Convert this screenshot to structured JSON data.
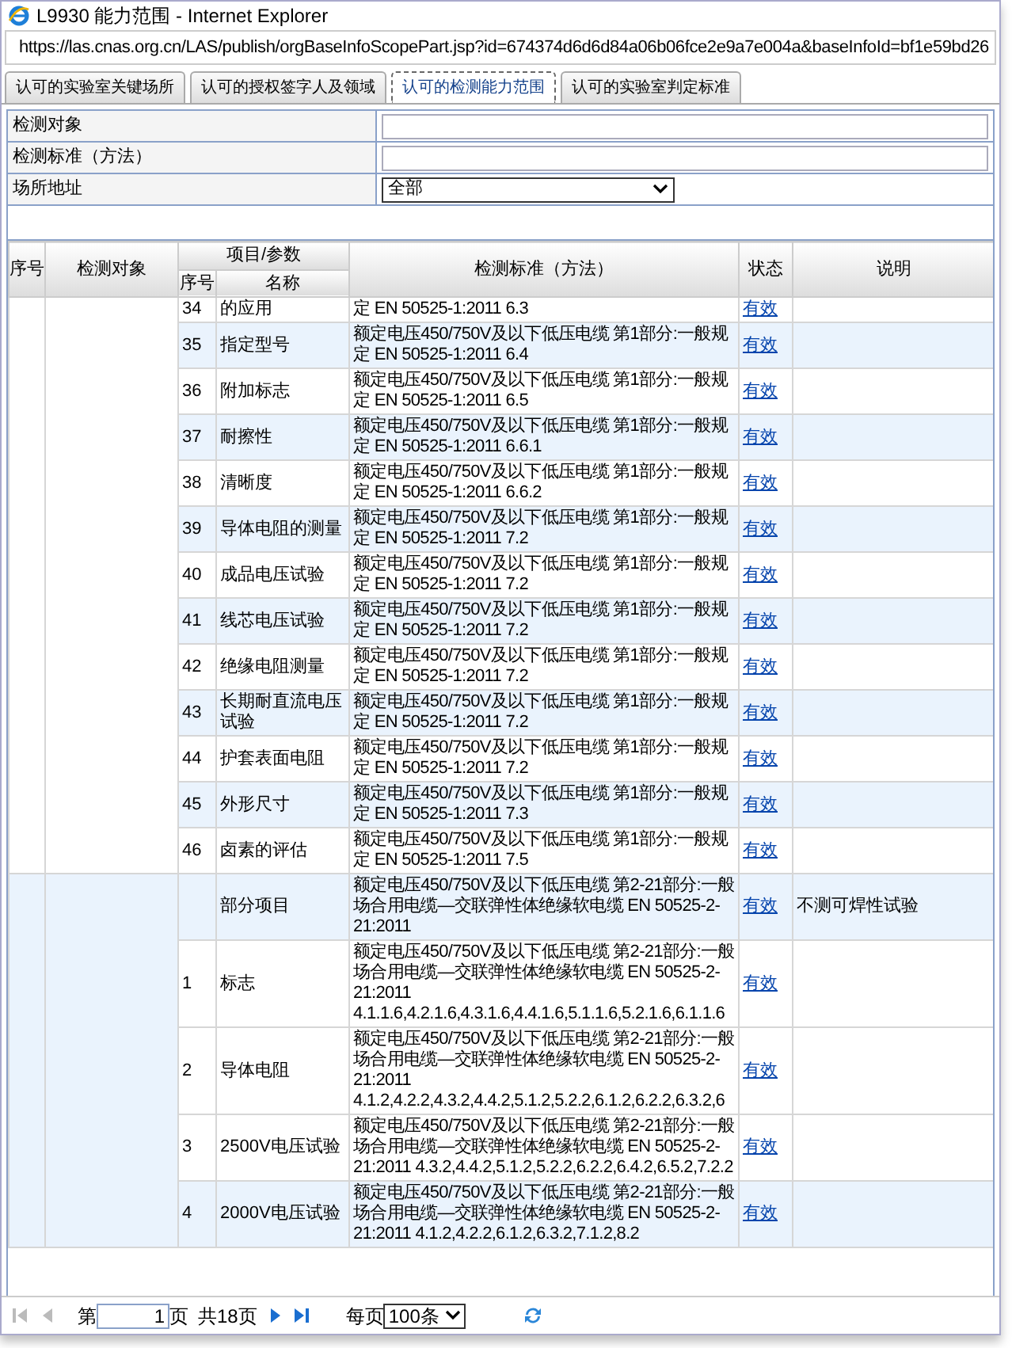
{
  "window": {
    "title": "L9930 能力范围 - Internet Explorer"
  },
  "address_bar": {
    "url": "https://las.cnas.org.cn/LAS/publish/orgBaseInfoScopePart.jsp?id=674374d6d6d84a06b06fce2e9a7e004a&baseInfoId=bf1e59bd26"
  },
  "tabs": [
    {
      "label": "认可的实验室关键场所",
      "selected": false
    },
    {
      "label": "认可的授权签字人及领域",
      "selected": false
    },
    {
      "label": "认可的检测能力范围",
      "selected": true
    },
    {
      "label": "认可的实验室判定标准",
      "selected": false
    }
  ],
  "filters": [
    {
      "kind": "text",
      "label": "检测对象"
    },
    {
      "kind": "text",
      "label": "检测标准（方法）"
    },
    {
      "kind": "select",
      "label": "场所地址",
      "value": "全部"
    }
  ],
  "table": {
    "columns": {
      "seq": "序号",
      "object": "检测对象",
      "item_group": "项目/参数",
      "item_seq": "序号",
      "item_name": "名称",
      "standard": "检测标准（方法）",
      "status": "状态",
      "note": "说明"
    },
    "groups": [
      {
        "selected": false,
        "rows": [
          {
            "seq": "34",
            "name": "的应用",
            "standard": "定 EN 50525-1:2011 6.3",
            "status": "有效",
            "shaded": false
          },
          {
            "seq": "35",
            "name": "指定型号",
            "standard": "额定电压450/750V及以下低压电缆 第1部分:一般规定 EN 50525-1:2011 6.4",
            "status": "有效",
            "shaded": true
          },
          {
            "seq": "36",
            "name": "附加标志",
            "standard": "额定电压450/750V及以下低压电缆 第1部分:一般规定 EN 50525-1:2011 6.5",
            "status": "有效",
            "shaded": false
          },
          {
            "seq": "37",
            "name": "耐擦性",
            "standard": "额定电压450/750V及以下低压电缆 第1部分:一般规定 EN 50525-1:2011 6.6.1",
            "status": "有效",
            "shaded": true
          },
          {
            "seq": "38",
            "name": "清晰度",
            "standard": "额定电压450/750V及以下低压电缆 第1部分:一般规定 EN 50525-1:2011 6.6.2",
            "status": "有效",
            "shaded": false
          },
          {
            "seq": "39",
            "name": "导体电阻的测量",
            "standard": "额定电压450/750V及以下低压电缆 第1部分:一般规定 EN 50525-1:2011 7.2",
            "status": "有效",
            "shaded": true
          },
          {
            "seq": "40",
            "name": "成品电压试验",
            "standard": "额定电压450/750V及以下低压电缆 第1部分:一般规定 EN 50525-1:2011 7.2",
            "status": "有效",
            "shaded": false
          },
          {
            "seq": "41",
            "name": "线芯电压试验",
            "standard": "额定电压450/750V及以下低压电缆 第1部分:一般规定 EN 50525-1:2011 7.2",
            "status": "有效",
            "shaded": true
          },
          {
            "seq": "42",
            "name": "绝缘电阻测量",
            "standard": "额定电压450/750V及以下低压电缆 第1部分:一般规定 EN 50525-1:2011 7.2",
            "status": "有效",
            "shaded": false
          },
          {
            "seq": "43",
            "name": "长期耐直流电压试验",
            "standard": "额定电压450/750V及以下低压电缆 第1部分:一般规定 EN 50525-1:2011 7.2",
            "status": "有效",
            "shaded": true
          },
          {
            "seq": "44",
            "name": "护套表面电阻",
            "standard": "额定电压450/750V及以下低压电缆 第1部分:一般规定 EN 50525-1:2011 7.2",
            "status": "有效",
            "shaded": false
          },
          {
            "seq": "45",
            "name": "外形尺寸",
            "standard": "额定电压450/750V及以下低压电缆 第1部分:一般规定 EN 50525-1:2011 7.3",
            "status": "有效",
            "shaded": true
          },
          {
            "seq": "46",
            "name": "卤素的评估",
            "standard": "额定电压450/750V及以下低压电缆 第1部分:一般规定 EN 50525-1:2011 7.5",
            "status": "有效",
            "shaded": false
          }
        ]
      },
      {
        "selected": true,
        "rows": [
          {
            "name": "部分项目",
            "standard": "额定电压450/750V及以下低压电缆 第2-21部分:一般场合用电缆—交联弹性体绝缘软电缆 EN 50525-2-21:2011",
            "status": "有效",
            "note": "不测可焊性试验",
            "shaded": true
          },
          {
            "seq": "1",
            "name": "标志",
            "standard": "额定电压450/750V及以下低压电缆 第2-21部分:一般场合用电缆—交联弹性体绝缘软电缆 EN 50525-2-21:2011 4.1.1.6,4.2.1.6,4.3.1.6,4.4.1.6,5.1.1.6,5.2.1.6,6.1.1.6",
            "status": "有效",
            "shaded": false
          },
          {
            "seq": "2",
            "name": "导体电阻",
            "standard": "额定电压450/750V及以下低压电缆 第2-21部分:一般场合用电缆—交联弹性体绝缘软电缆 EN 50525-2-21:2011 4.1.2,4.2.2,4.3.2,4.4.2,5.1.2,5.2.2,6.1.2,6.2.2,6.3.2,6",
            "status": "有效",
            "shaded": false
          },
          {
            "seq": "3",
            "name": "2500V电压试验",
            "standard": "额定电压450/750V及以下低压电缆 第2-21部分:一般场合用电缆—交联弹性体绝缘软电缆 EN 50525-2-21:2011 4.3.2,4.4.2,5.1.2,5.2.2,6.2.2,6.4.2,6.5.2,7.2.2",
            "status": "有效",
            "shaded": false
          },
          {
            "seq": "4",
            "name": "2000V电压试验",
            "standard": "额定电压450/750V及以下低压电缆 第2-21部分:一般场合用电缆—交联弹性体绝缘软电缆 EN 50525-2-21:2011 4.1.2,4.2.2,6.1.2,6.3.2,7.1.2,8.2",
            "status": "有效",
            "shaded": true
          }
        ]
      }
    ]
  },
  "pager": {
    "page_prefix": "第",
    "page": "1",
    "page_suffix": "页",
    "total": "共18页",
    "per_page_label": "每页",
    "per_page": "100条"
  }
}
